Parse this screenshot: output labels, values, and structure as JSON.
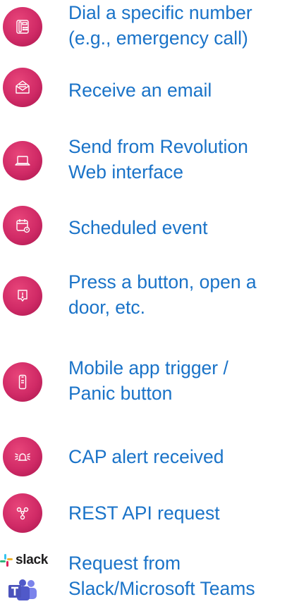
{
  "triggers": [
    {
      "icon": "desk-phone-icon",
      "lines": [
        "Dial a specific number",
        "(e.g., emergency call)"
      ]
    },
    {
      "icon": "envelope-icon",
      "lines": [
        "Receive an email"
      ]
    },
    {
      "icon": "laptop-icon",
      "lines": [
        "Send from Revolution",
        "Web interface"
      ]
    },
    {
      "icon": "calendar-clock-icon",
      "lines": [
        "Scheduled event"
      ]
    },
    {
      "icon": "alert-button-icon",
      "lines": [
        "Press a button, open a",
        "door, etc."
      ]
    },
    {
      "icon": "mobile-phone-icon",
      "lines": [
        "Mobile app trigger /",
        "Panic button"
      ]
    },
    {
      "icon": "siren-icon",
      "lines": [
        "CAP alert received"
      ]
    },
    {
      "icon": "api-nodes-icon",
      "lines": [
        "REST API request"
      ]
    },
    {
      "icon": "slack-teams-logos",
      "logo_text": "slack",
      "lines": [
        "Request from",
        "Slack/Microsoft Teams"
      ]
    }
  ],
  "colors": {
    "label": "#1a73c8",
    "icon_bg": "#d02a66",
    "icon_stroke": "#ffffff"
  }
}
